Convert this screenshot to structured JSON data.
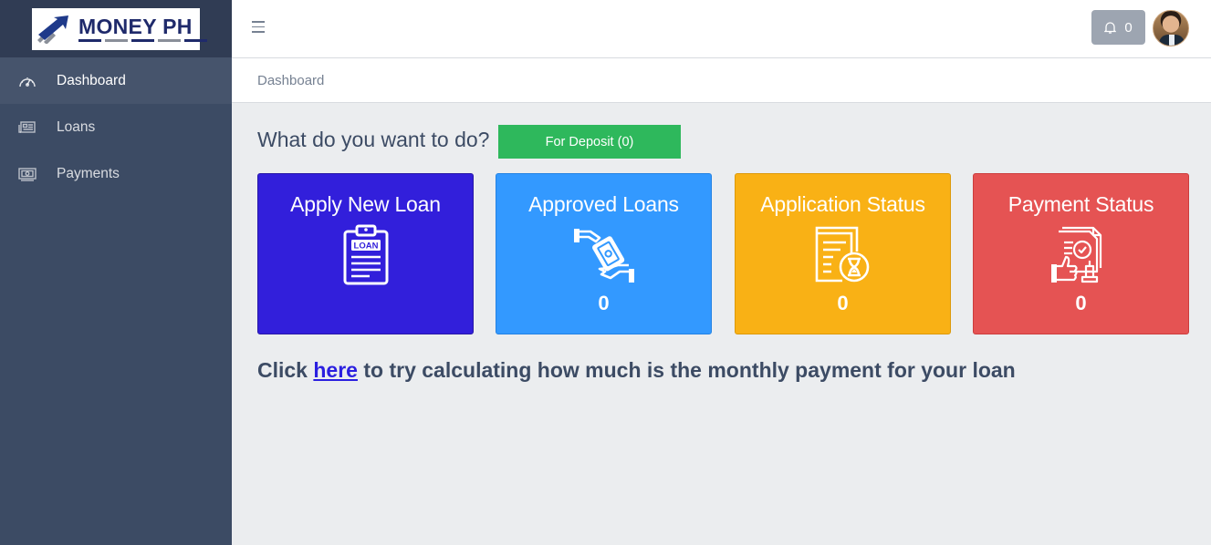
{
  "brand": {
    "logo_text": "MONEY PH",
    "logo_icon": "chart-arrow-icon"
  },
  "sidebar": {
    "items": [
      {
        "label": "Dashboard",
        "icon": "speedometer-icon",
        "active": true
      },
      {
        "label": "Loans",
        "icon": "newspaper-icon",
        "active": false
      },
      {
        "label": "Payments",
        "icon": "money-bill-icon",
        "active": false
      }
    ]
  },
  "header": {
    "menu_icon": "hamburger-icon",
    "notifications_count": "0",
    "notifications_icon": "bell-icon"
  },
  "breadcrumb": {
    "current": "Dashboard"
  },
  "main": {
    "question": "What do you want to do?",
    "deposit_button": "For Deposit (0)",
    "cards": [
      {
        "title": "Apply New Loan",
        "icon": "loan-clipboard-icon",
        "color": "#321fdb"
      },
      {
        "title": "Approved Loans",
        "icon": "hand-money-icon",
        "count": "0",
        "color": "#3399ff"
      },
      {
        "title": "Application Status",
        "icon": "document-hourglass-icon",
        "count": "0",
        "color": "#f9b115"
      },
      {
        "title": "Payment Status",
        "icon": "invoice-approval-icon",
        "count": "0",
        "color": "#e55353"
      }
    ],
    "calc": {
      "prefix": "Click ",
      "link": "here",
      "suffix": " to try calculating how much is the monthly payment for your loan"
    }
  },
  "colors": {
    "sidebar": "#3c4b64",
    "success": "#2eb85c",
    "primary": "#321fdb",
    "info": "#3399ff",
    "warning": "#f9b115",
    "danger": "#e55353"
  }
}
